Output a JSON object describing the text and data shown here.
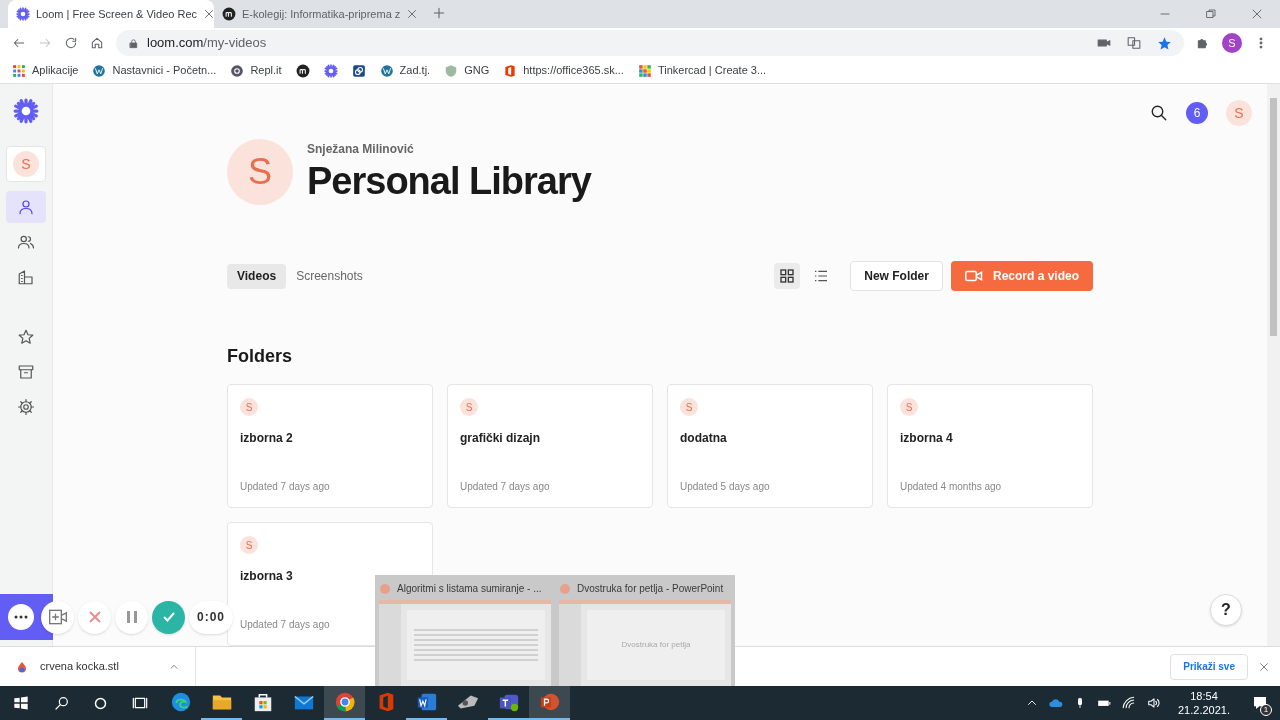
{
  "browser": {
    "tabs": [
      {
        "title": "Loom | Free Screen & Video Rec",
        "selected": true
      },
      {
        "title": "E-kolegij: Informatika-priprema z",
        "selected": false
      }
    ],
    "url_host": "loom.com",
    "url_path": "/my-videos",
    "profile_initial": "S",
    "bookmarks": [
      {
        "kind": "link",
        "label": "Aplikacije"
      },
      {
        "kind": "link",
        "label": "Nastavnici - Početn..."
      },
      {
        "kind": "link",
        "label": "Repl.it"
      },
      {
        "kind": "icon"
      },
      {
        "kind": "icon"
      },
      {
        "kind": "icon"
      },
      {
        "kind": "link",
        "label": "Zad.tj."
      },
      {
        "kind": "link",
        "label": "GNG"
      },
      {
        "kind": "link",
        "label": "https://office365.sk..."
      },
      {
        "kind": "link",
        "label": "Tinkercad | Create 3..."
      }
    ]
  },
  "sidebar": {
    "avatar": "S",
    "items": [
      {
        "selected": true
      },
      {
        "selected": false
      },
      {
        "selected": false
      },
      {
        "selected": false
      },
      {
        "selected": false
      },
      {
        "selected": false
      }
    ]
  },
  "topbar": {
    "notifications": "6",
    "avatar": "S"
  },
  "header": {
    "avatar": "S",
    "owner": "Snježana Milinović",
    "title": "Personal Library"
  },
  "tabs": [
    {
      "label": "Videos",
      "selected": true
    },
    {
      "label": "Screenshots",
      "selected": false
    }
  ],
  "view": {
    "grid_selected": true
  },
  "actions": {
    "new_folder": "New Folder",
    "record": "Record a video"
  },
  "folders_title": "Folders",
  "folders": [
    {
      "avatar": "S",
      "name": "izborna 2",
      "updated": "Updated 7 days ago"
    },
    {
      "avatar": "S",
      "name": "grafički dizajn",
      "updated": "Updated 7 days ago"
    },
    {
      "avatar": "S",
      "name": "dodatna",
      "updated": "Updated 5 days ago"
    },
    {
      "avatar": "S",
      "name": "izborna 4",
      "updated": "Updated 4 months ago"
    },
    {
      "avatar": "S",
      "name": "izborna 3",
      "updated": "Updated 7 days ago"
    }
  ],
  "recorder": {
    "timer": "0:00"
  },
  "help": "?",
  "download": {
    "file": "crvena kocka.stl",
    "show_all": "Prikaži sve"
  },
  "previews": [
    {
      "title": "Algoritmi s listama sumiranje - ..."
    },
    {
      "title": "Dvostruka for petlja - PowerPoint",
      "slide_text": "Dvostruka for petlja"
    }
  ],
  "taskbar": {
    "time": "18:54",
    "date": "21.2.2021.",
    "notification_count": "1",
    "apps": [
      {
        "kind": "edge",
        "running": false
      },
      {
        "kind": "explorer",
        "running": true
      },
      {
        "kind": "store",
        "running": false
      },
      {
        "kind": "mail",
        "running": false
      },
      {
        "kind": "chrome",
        "running": true
      },
      {
        "kind": "office",
        "running": false
      },
      {
        "kind": "word",
        "running": true
      },
      {
        "kind": "misc",
        "running": false
      },
      {
        "kind": "teams",
        "running": true
      },
      {
        "kind": "powerpoint",
        "running": true
      }
    ]
  }
}
